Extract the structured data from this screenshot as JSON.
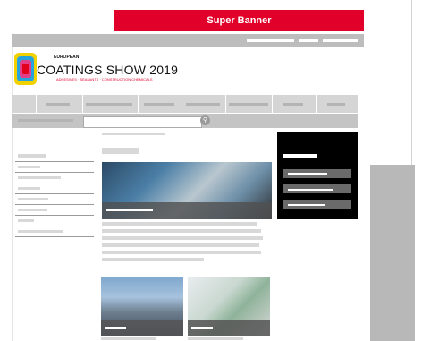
{
  "super_banner": {
    "label": "Super Banner",
    "color": "#e0002a"
  },
  "logo": {
    "top_word": "EUROPEAN",
    "title": "COATINGS SHOW 2019",
    "tagline": "ADHESIVES · SEALANTS · CONSTRUCTION CHEMICALS"
  },
  "search": {
    "placeholder": ""
  }
}
